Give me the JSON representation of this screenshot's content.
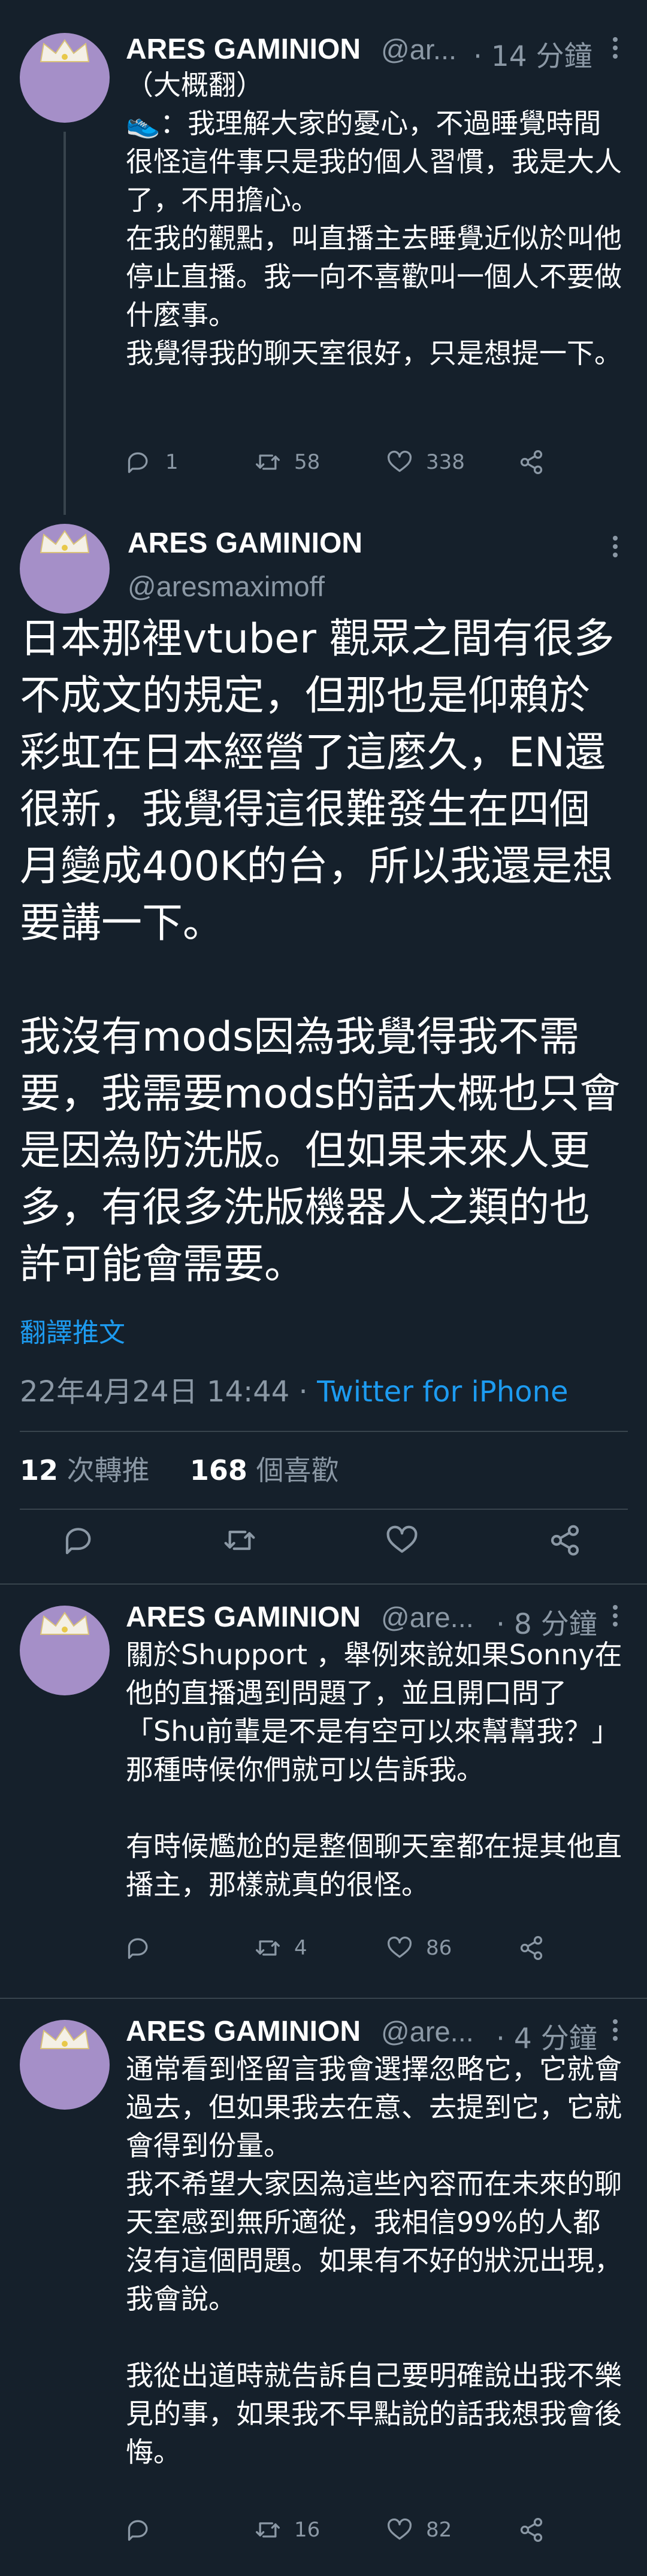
{
  "author": {
    "name": "ARES GAMINION",
    "handle_short": "@ar...",
    "handle_short2": "@are...",
    "handle_full": "@aresmaximoff"
  },
  "tweet1": {
    "time": "· 14 分鐘",
    "text": "（大概翻）\n👟：我理解大家的憂心，不過睡覺時間很怪這件事只是我的個人習慣，我是大人了，不用擔心。\n在我的觀點，叫直播主去睡覺近似於叫他停止直播。我一向不喜歡叫一個人不要做什麼事。\n我覺得我的聊天室很好，只是想提一下。",
    "replies": "1",
    "retweets": "58",
    "likes": "338"
  },
  "main": {
    "text": "日本那裡vtuber 觀眾之間有很多不成文的規定，但那也是仰賴於彩虹在日本經營了這麼久，EN還很新，我覺得這很難發生在四個月變成400K的台，所以我還是想要講一下。\n\n我沒有mods因為我覺得我不需要，我需要mods的話大概也只會是因為防洗版。但如果未來人更多，有很多洗版機器人之類的也許可能會需要。",
    "translate": "翻譯推文",
    "date": "22年4月24日 14:44 · ",
    "source": "Twitter for iPhone",
    "retweet_count": "12",
    "retweet_label": " 次轉推",
    "like_count": "168",
    "like_label": " 個喜歡"
  },
  "tweet3": {
    "time": "· 8 分鐘",
    "text": "關於Shupport ，舉例來說如果Sonny在他的直播遇到問題了，並且開口問了「Shu前輩是不是有空可以來幫幫我？」那種時候你們就可以告訴我。\n\n有時候尷尬的是整個聊天室都在提其他直播主，那樣就真的很怪。",
    "replies": "",
    "retweets": "4",
    "likes": "86"
  },
  "tweet4": {
    "time": "· 4 分鐘",
    "text": "通常看到怪留言我會選擇忽略它，它就會過去，但如果我去在意、去提到它，它就會得到份量。\n我不希望大家因為這些內容而在未來的聊天室感到無所適從，我相信99%的人都沒有這個問題。如果有不好的狀況出現，我會說。\n\n我從出道時就告訴自己要明確說出我不樂見的事，如果我不早點說的話我想我會後悔。",
    "replies": "",
    "retweets": "16",
    "likes": "82"
  },
  "icons": [
    "reply-icon",
    "retweet-icon",
    "like-icon",
    "share-icon",
    "more-icon"
  ],
  "colors": {
    "background": "#15202b",
    "secondary_text": "#8b98a5",
    "link": "#1d9bf0",
    "divider": "#38444d",
    "avatar": "#a58fc8"
  }
}
